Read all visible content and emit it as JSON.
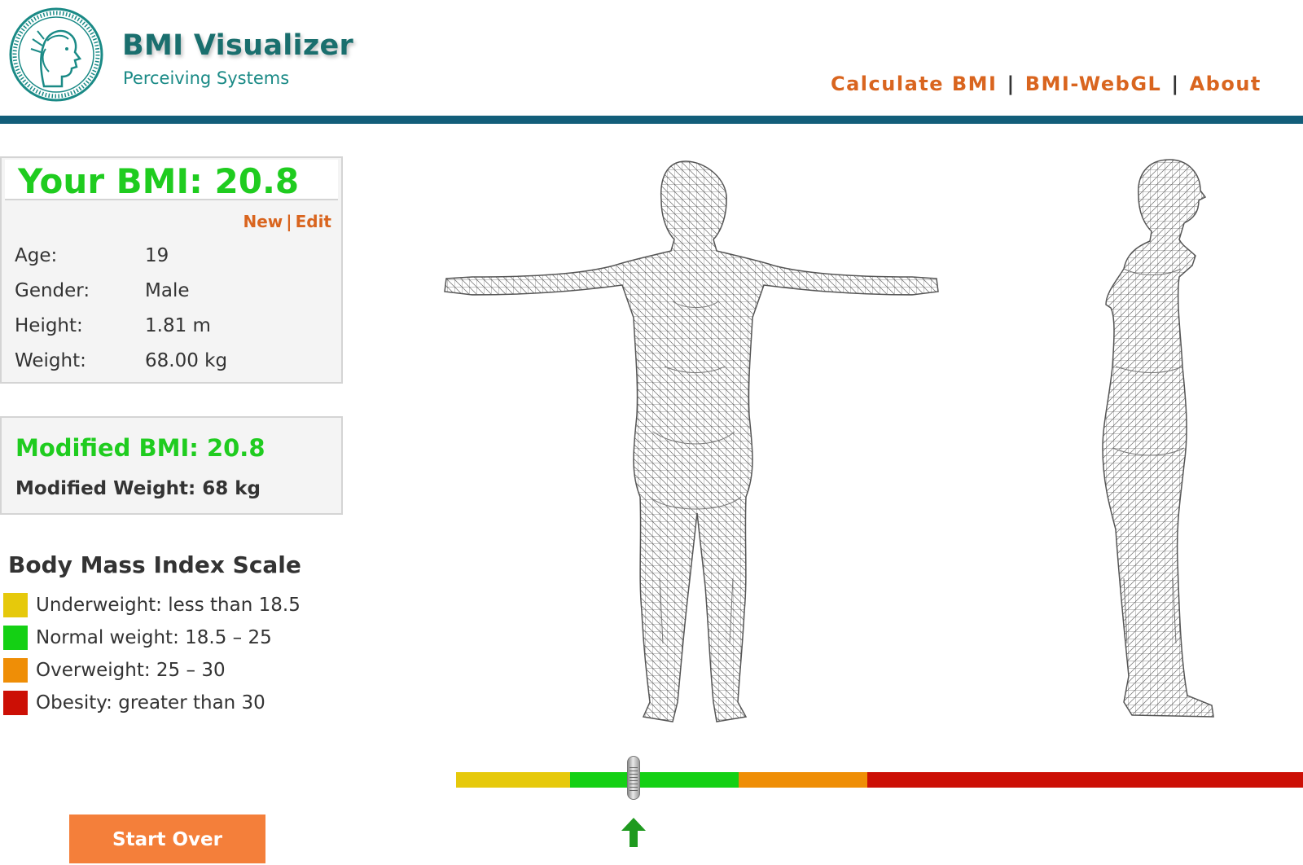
{
  "header": {
    "title": "BMI Visualizer",
    "subtitle": "Perceiving Systems",
    "nav": [
      "Calculate BMI",
      "BMI-WebGL",
      "About"
    ]
  },
  "bmi_panel": {
    "title": "Your BMI: 20.8",
    "new_label": "New",
    "separator": "|",
    "edit_label": "Edit",
    "fields": [
      {
        "label": "Age:",
        "value": "19"
      },
      {
        "label": "Gender:",
        "value": "Male"
      },
      {
        "label": "Height:",
        "value": "1.81 m"
      },
      {
        "label": "Weight:",
        "value": "68.00 kg"
      }
    ]
  },
  "modified": {
    "bmi": "Modified BMI: 20.8",
    "weight": "Modified Weight: 68 kg"
  },
  "scale": {
    "title": "Body Mass Index Scale",
    "items": [
      {
        "label": "Underweight: less than 18.5",
        "color": "#e6c90b"
      },
      {
        "label": "Normal weight: 18.5 – 25",
        "color": "#14d014"
      },
      {
        "label": "Overweight: 25 – 30",
        "color": "#ef8e06"
      },
      {
        "label": "Obesity: greater than 30",
        "color": "#cc0f05"
      }
    ]
  },
  "actions": {
    "start_over": "Start Over"
  },
  "slider": {
    "segments": [
      {
        "color": "#e6c90b"
      },
      {
        "color": "#14d014"
      },
      {
        "color": "#ef8e06"
      },
      {
        "color": "#cc0f05"
      }
    ],
    "indicator_icon": "up-arrow-icon"
  }
}
